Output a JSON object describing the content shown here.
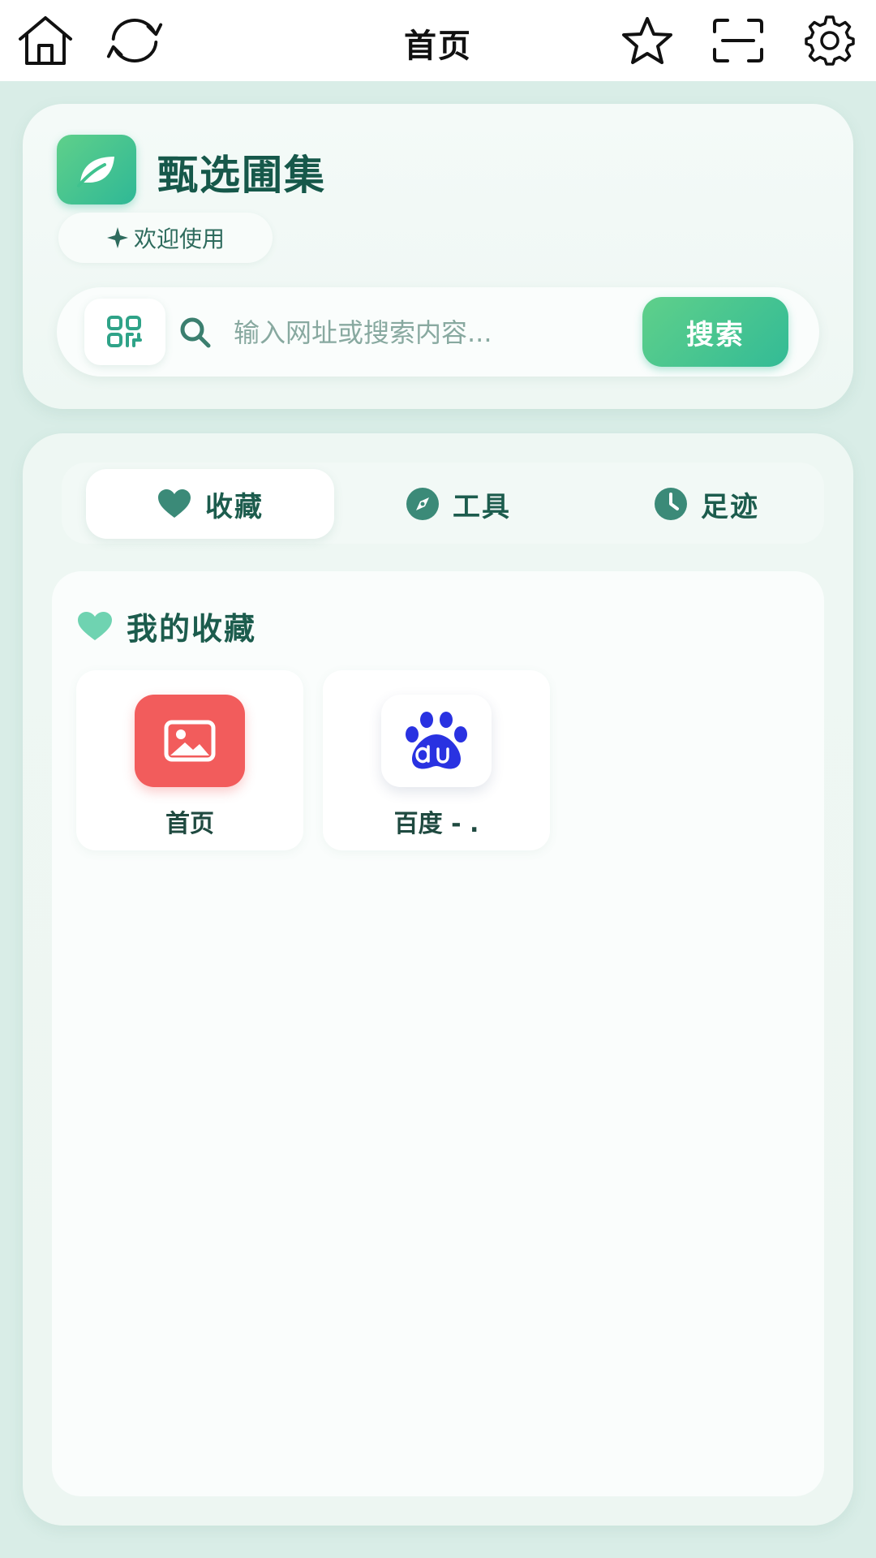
{
  "topbar": {
    "title": "首页",
    "icons": [
      "home-icon",
      "refresh-icon",
      "star-icon",
      "scan-icon",
      "gear-icon"
    ]
  },
  "header": {
    "brand": "甄选圃集",
    "welcome": "欢迎使用",
    "search": {
      "placeholder": "输入网址或搜索内容...",
      "value": "",
      "button_label": "搜索"
    }
  },
  "tabs": [
    {
      "label": "收藏",
      "icon": "heart-icon",
      "active": true
    },
    {
      "label": "工具",
      "icon": "compass-icon",
      "active": false
    },
    {
      "label": "足迹",
      "icon": "clock-icon",
      "active": false
    }
  ],
  "favorites": {
    "title": "我的收藏",
    "items": [
      {
        "label": "首页",
        "icon": "image-icon"
      },
      {
        "label": "百度 - .",
        "icon": "baidu-paw-icon"
      }
    ]
  },
  "colors": {
    "accent": "#3fc28e",
    "text_dark": "#1c5c4d",
    "background": "#d9ede7",
    "favorite_red": "#f25c5c",
    "baidu_blue": "#2932e1"
  }
}
